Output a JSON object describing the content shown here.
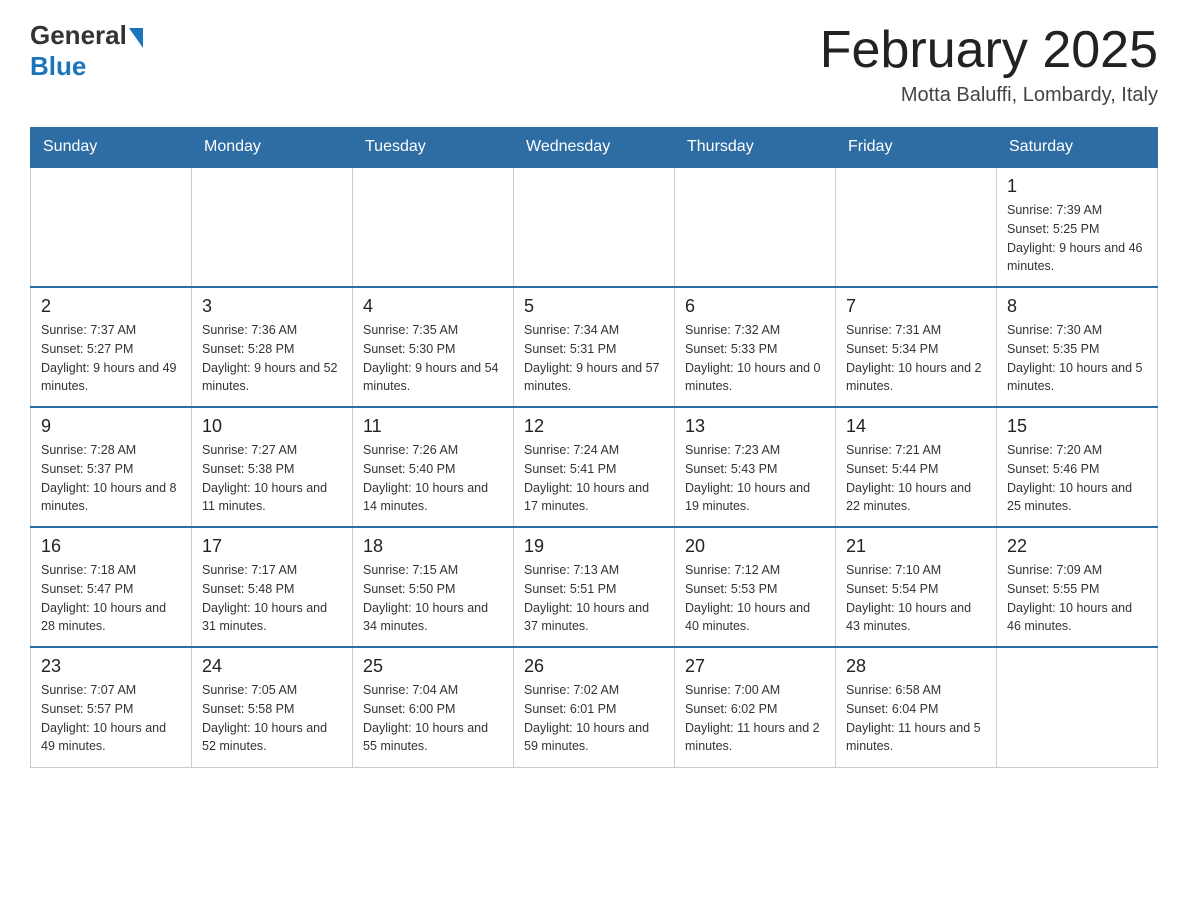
{
  "logo": {
    "general": "General",
    "blue": "Blue"
  },
  "title": "February 2025",
  "subtitle": "Motta Baluffi, Lombardy, Italy",
  "days_of_week": [
    "Sunday",
    "Monday",
    "Tuesday",
    "Wednesday",
    "Thursday",
    "Friday",
    "Saturday"
  ],
  "weeks": [
    [
      {
        "day": "",
        "info": ""
      },
      {
        "day": "",
        "info": ""
      },
      {
        "day": "",
        "info": ""
      },
      {
        "day": "",
        "info": ""
      },
      {
        "day": "",
        "info": ""
      },
      {
        "day": "",
        "info": ""
      },
      {
        "day": "1",
        "info": "Sunrise: 7:39 AM\nSunset: 5:25 PM\nDaylight: 9 hours and 46 minutes."
      }
    ],
    [
      {
        "day": "2",
        "info": "Sunrise: 7:37 AM\nSunset: 5:27 PM\nDaylight: 9 hours and 49 minutes."
      },
      {
        "day": "3",
        "info": "Sunrise: 7:36 AM\nSunset: 5:28 PM\nDaylight: 9 hours and 52 minutes."
      },
      {
        "day": "4",
        "info": "Sunrise: 7:35 AM\nSunset: 5:30 PM\nDaylight: 9 hours and 54 minutes."
      },
      {
        "day": "5",
        "info": "Sunrise: 7:34 AM\nSunset: 5:31 PM\nDaylight: 9 hours and 57 minutes."
      },
      {
        "day": "6",
        "info": "Sunrise: 7:32 AM\nSunset: 5:33 PM\nDaylight: 10 hours and 0 minutes."
      },
      {
        "day": "7",
        "info": "Sunrise: 7:31 AM\nSunset: 5:34 PM\nDaylight: 10 hours and 2 minutes."
      },
      {
        "day": "8",
        "info": "Sunrise: 7:30 AM\nSunset: 5:35 PM\nDaylight: 10 hours and 5 minutes."
      }
    ],
    [
      {
        "day": "9",
        "info": "Sunrise: 7:28 AM\nSunset: 5:37 PM\nDaylight: 10 hours and 8 minutes."
      },
      {
        "day": "10",
        "info": "Sunrise: 7:27 AM\nSunset: 5:38 PM\nDaylight: 10 hours and 11 minutes."
      },
      {
        "day": "11",
        "info": "Sunrise: 7:26 AM\nSunset: 5:40 PM\nDaylight: 10 hours and 14 minutes."
      },
      {
        "day": "12",
        "info": "Sunrise: 7:24 AM\nSunset: 5:41 PM\nDaylight: 10 hours and 17 minutes."
      },
      {
        "day": "13",
        "info": "Sunrise: 7:23 AM\nSunset: 5:43 PM\nDaylight: 10 hours and 19 minutes."
      },
      {
        "day": "14",
        "info": "Sunrise: 7:21 AM\nSunset: 5:44 PM\nDaylight: 10 hours and 22 minutes."
      },
      {
        "day": "15",
        "info": "Sunrise: 7:20 AM\nSunset: 5:46 PM\nDaylight: 10 hours and 25 minutes."
      }
    ],
    [
      {
        "day": "16",
        "info": "Sunrise: 7:18 AM\nSunset: 5:47 PM\nDaylight: 10 hours and 28 minutes."
      },
      {
        "day": "17",
        "info": "Sunrise: 7:17 AM\nSunset: 5:48 PM\nDaylight: 10 hours and 31 minutes."
      },
      {
        "day": "18",
        "info": "Sunrise: 7:15 AM\nSunset: 5:50 PM\nDaylight: 10 hours and 34 minutes."
      },
      {
        "day": "19",
        "info": "Sunrise: 7:13 AM\nSunset: 5:51 PM\nDaylight: 10 hours and 37 minutes."
      },
      {
        "day": "20",
        "info": "Sunrise: 7:12 AM\nSunset: 5:53 PM\nDaylight: 10 hours and 40 minutes."
      },
      {
        "day": "21",
        "info": "Sunrise: 7:10 AM\nSunset: 5:54 PM\nDaylight: 10 hours and 43 minutes."
      },
      {
        "day": "22",
        "info": "Sunrise: 7:09 AM\nSunset: 5:55 PM\nDaylight: 10 hours and 46 minutes."
      }
    ],
    [
      {
        "day": "23",
        "info": "Sunrise: 7:07 AM\nSunset: 5:57 PM\nDaylight: 10 hours and 49 minutes."
      },
      {
        "day": "24",
        "info": "Sunrise: 7:05 AM\nSunset: 5:58 PM\nDaylight: 10 hours and 52 minutes."
      },
      {
        "day": "25",
        "info": "Sunrise: 7:04 AM\nSunset: 6:00 PM\nDaylight: 10 hours and 55 minutes."
      },
      {
        "day": "26",
        "info": "Sunrise: 7:02 AM\nSunset: 6:01 PM\nDaylight: 10 hours and 59 minutes."
      },
      {
        "day": "27",
        "info": "Sunrise: 7:00 AM\nSunset: 6:02 PM\nDaylight: 11 hours and 2 minutes."
      },
      {
        "day": "28",
        "info": "Sunrise: 6:58 AM\nSunset: 6:04 PM\nDaylight: 11 hours and 5 minutes."
      },
      {
        "day": "",
        "info": ""
      }
    ]
  ]
}
